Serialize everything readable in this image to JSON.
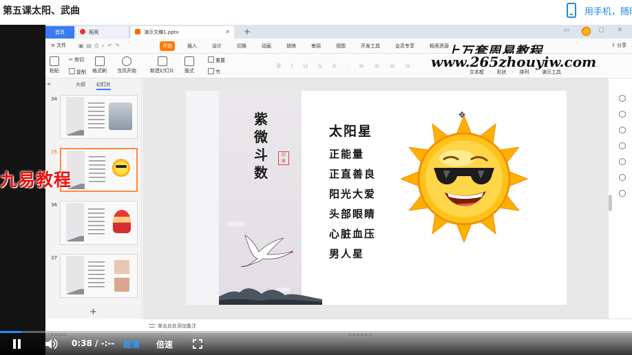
{
  "page": {
    "lesson_title": "第五课太阳、武曲",
    "phone_link": "用手机，随时"
  },
  "tabs": [
    {
      "label": "首页",
      "icon": "home-icon"
    },
    {
      "label": "稻壳",
      "icon": "daoke-icon"
    },
    {
      "label": "演示文稿1.pptx",
      "icon": "pptx-file-icon"
    }
  ],
  "menu": {
    "file": "文件",
    "items": [
      "开始",
      "插入",
      "设计",
      "切换",
      "动画",
      "放映",
      "审阅",
      "视图",
      "开发工具",
      "会员专享",
      "稻壳资源"
    ],
    "active_index": 0,
    "right_items": "分享"
  },
  "ribbon": {
    "paste": "粘贴",
    "cut": "剪切",
    "copy": "复制",
    "format_painter": "格式刷",
    "play_from_current": "当页开始",
    "new_slide": "新建幻灯片",
    "layout": "版式",
    "section": "节",
    "reset": "重置",
    "right_tools": "文本框 · 形状 · 排列 · 演示工具"
  },
  "watermarks": {
    "top": "上万套周易教程",
    "url": "www.265zhouyiw.com",
    "overlay": "九易教程"
  },
  "left_panel": {
    "tab_outline": "大纲",
    "tab_slides": "幻灯片",
    "thumbnails": [
      {
        "number": "34",
        "picture": "person-photo"
      },
      {
        "number": "35",
        "picture": "sun-emoji"
      },
      {
        "number": "36",
        "picture": "caishen-figure"
      },
      {
        "number": "37",
        "picture": "face-photos"
      }
    ],
    "selected_index": 1
  },
  "slide": {
    "vertical_title": "紫微斗数",
    "heading": "太阳星",
    "items": [
      "正能量",
      "正直善良",
      "阳光大爱",
      "头部眼睛",
      "心脏血压",
      "男人星"
    ],
    "image": "sunglasses-sun-icon"
  },
  "notes": {
    "placeholder": "单击此处添加备注"
  },
  "player": {
    "time_current": "0:38",
    "time_separator": "/",
    "time_total": "-:--",
    "quality": "超清",
    "speed": "倍速",
    "progress_fraction": 0.035
  },
  "colors": {
    "accent_orange": "#ff7a00",
    "tab_blue": "#3a7bf2",
    "link_blue": "#1e88e5",
    "overlay_red": "#e8140f"
  }
}
